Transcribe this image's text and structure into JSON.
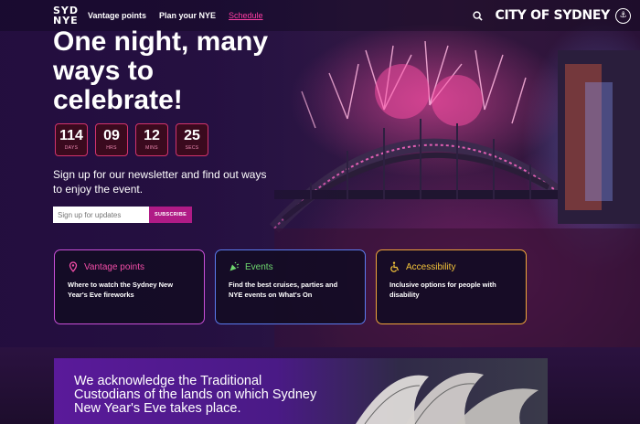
{
  "nav": {
    "logo_line1": "SYD",
    "logo_line2": "NYE",
    "links": [
      "Vantage points",
      "Plan your NYE",
      "Schedule"
    ],
    "city_logo": "CITY OF SYDNEY"
  },
  "hero": {
    "title": "One night, many ways to celebrate!",
    "countdown": [
      {
        "value": "114",
        "label": "DAYS"
      },
      {
        "value": "09",
        "label": "HRS"
      },
      {
        "value": "12",
        "label": "MINS"
      },
      {
        "value": "25",
        "label": "SECS"
      }
    ],
    "signup_text": "Sign up for our newsletter and find out ways to enjoy the event.",
    "signup_placeholder": "Sign up for updates",
    "subscribe_label": "SUBSCRIBE"
  },
  "cards": [
    {
      "title": "Vantage points",
      "desc": "Where to watch the Sydney New Year's Eve fireworks",
      "icon": "map-pin-icon",
      "color": "#f14da7"
    },
    {
      "title": "Events",
      "desc": "Find the best cruises, parties and NYE events on What's On",
      "icon": "party-popper-icon",
      "color": "#6fd96f"
    },
    {
      "title": "Accessibility",
      "desc": "Inclusive options for people with disability",
      "icon": "accessibility-icon",
      "color": "#f5c53a"
    }
  ],
  "acknowledgement": "We acknowledge the Traditional Custodians of the lands on which Sydney New Year's Eve takes place."
}
